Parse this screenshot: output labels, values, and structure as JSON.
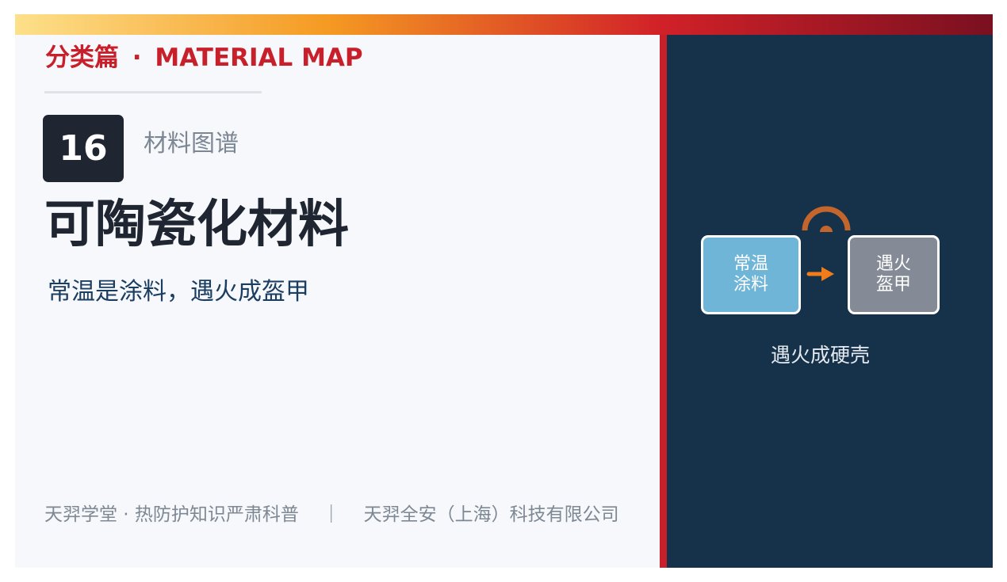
{
  "section": {
    "label_cn": "分类篇",
    "label_sep": "·",
    "label_en": "MATERIAL MAP"
  },
  "badge": {
    "number": "16",
    "caption": "材料图谱"
  },
  "title": "可陶瓷化材料",
  "subtitle": "常温是涂料，遇火成盔甲",
  "footer": {
    "left": "天羿学堂 · 热防护知识严肃科普",
    "separator": "｜",
    "right": "天羿全安（上海）科技有限公司"
  },
  "diagram": {
    "before_line1": "常温",
    "before_line2": "涂料",
    "after_line1": "遇火",
    "after_line2": "盔甲",
    "caption": "遇火成硬壳",
    "icons": [
      "flame-icon",
      "arrow-right-icon"
    ]
  },
  "colors": {
    "accent_red": "#c8202b",
    "dark_navy": "#16324a",
    "badge_dark": "#1f2631",
    "subtitle_blue": "#1b3d60",
    "card_blue": "#6fb5d7",
    "card_gray": "#848b96",
    "flame_orange": "#c4662b",
    "arrow_orange": "#f07d19",
    "gradient": [
      "#fde08a",
      "#f59a22",
      "#d12128",
      "#7a1020"
    ]
  }
}
